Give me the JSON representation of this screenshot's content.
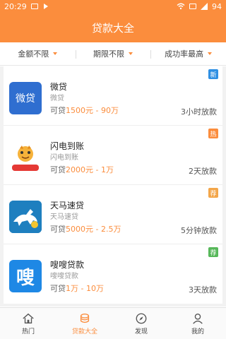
{
  "status": {
    "time": "20:29",
    "battery": "94"
  },
  "header": {
    "title": "贷款大全"
  },
  "filters": [
    {
      "label": "金额不限"
    },
    {
      "label": "期限不限"
    },
    {
      "label": "成功率最高"
    }
  ],
  "loans": [
    {
      "name": "微贷",
      "subtitle": "微贷",
      "range_prefix": "可贷",
      "range_value": "1500元 - 90万",
      "speed": "3小时放款",
      "tag": "新",
      "tag_color": "#2e8fe3",
      "logo_text": "微贷"
    },
    {
      "name": "闪电到账",
      "subtitle": "闪电到账",
      "range_prefix": "可贷",
      "range_value": "2000元 - 1万",
      "speed": "2天放款",
      "tag": "热",
      "tag_color": "#fb8d3d",
      "logo_text": "闪电到账"
    },
    {
      "name": "天马速贷",
      "subtitle": "天马速贷",
      "range_prefix": "可贷",
      "range_value": "5000元 - 2.5万",
      "speed": "5分钟放款",
      "tag": "荐",
      "tag_color": "#f3a64a"
    },
    {
      "name": "嗖嗖贷款",
      "subtitle": "嗖嗖贷款",
      "range_prefix": "可贷",
      "range_value": "1万 - 10万",
      "speed": "3天放款",
      "tag": "荐",
      "tag_color": "#57b85a",
      "logo_text": "嗖"
    }
  ],
  "bottom_nav": [
    {
      "label": "热门",
      "icon": "home-icon"
    },
    {
      "label": "贷款大全",
      "icon": "coins-icon"
    },
    {
      "label": "发现",
      "icon": "compass-icon"
    },
    {
      "label": "我的",
      "icon": "user-icon"
    }
  ],
  "colors": {
    "accent": "#fb8d3d"
  }
}
